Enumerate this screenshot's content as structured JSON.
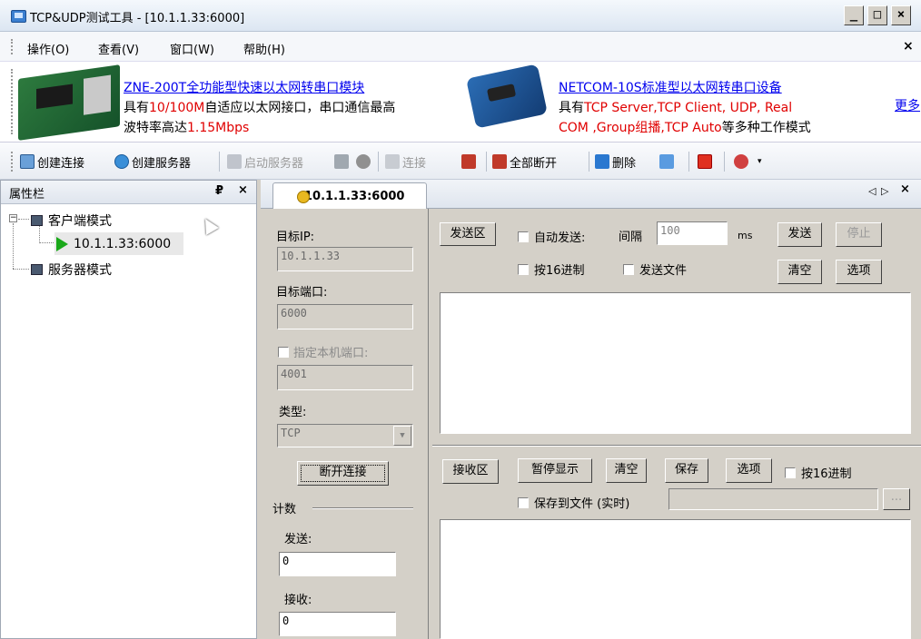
{
  "window": {
    "title": "TCP&UDP测试工具 - [10.1.1.33:6000]",
    "min": "_",
    "max": "□",
    "close": "×"
  },
  "menu": {
    "items": [
      "操作(O)",
      "查看(V)",
      "窗口(W)",
      "帮助(H)"
    ],
    "close": "×"
  },
  "ads": {
    "product1_title": "ZNE-200T全功能型快速以太网转串口模块",
    "product1_line1_a": "具有",
    "product1_line1_b": "10/100M",
    "product1_line1_c": "自适应以太网接口，串口通信最高",
    "product1_line2_a": "波特率高达",
    "product1_line2_b": "1.15Mbps",
    "product2_title": "NETCOM-10S标准型以太网转串口设备",
    "product2_line1_a": "具有",
    "product2_line1_b": "TCP Server,TCP Client, UDP, Real",
    "product2_line2_a": "COM ,Group组播,TCP Auto",
    "product2_line2_b": "等多种工作模式",
    "more": "更多"
  },
  "toolbar": {
    "create_connection": "创建连接",
    "create_server": "创建服务器",
    "start_server": "启动服务器",
    "connect": "连接",
    "disconnect_all": "全部断开",
    "delete": "删除"
  },
  "left_panel": {
    "title": "属性栏",
    "pin": "₽",
    "close": "×",
    "client_mode": "客户端模式",
    "client_conn": "10.1.1.33:6000",
    "server_mode": "服务器模式"
  },
  "tab": {
    "label": "10.1.1.33:6000",
    "nav_left": "◁",
    "nav_right": "▷",
    "close": "×"
  },
  "config": {
    "target_ip_label": "目标IP:",
    "target_ip": "10.1.1.33",
    "target_port_label": "目标端口:",
    "target_port": "6000",
    "local_port_label": "指定本机端口:",
    "local_port": "4001",
    "type_label": "类型:",
    "type_value": "TCP",
    "disconnect_button": "断开连接",
    "count_label": "计数",
    "send_label": "发送:",
    "send_value": "0",
    "recv_label": "接收:",
    "recv_value": "0"
  },
  "send_area": {
    "label": "发送区",
    "auto_send": "自动发送:",
    "interval": "间隔",
    "interval_value": "100",
    "ms": "ms",
    "send_button": "发送",
    "stop_button": "停止",
    "hex": "按16进制",
    "send_file": "发送文件",
    "clear_button": "清空",
    "options_button": "选项"
  },
  "recv_area": {
    "label": "接收区",
    "pause_button": "暂停显示",
    "clear_button": "清空",
    "save_button": "保存",
    "options_button": "选项",
    "hex": "按16进制",
    "save_to_file": "保存到文件 (实时)",
    "browse": "..."
  }
}
